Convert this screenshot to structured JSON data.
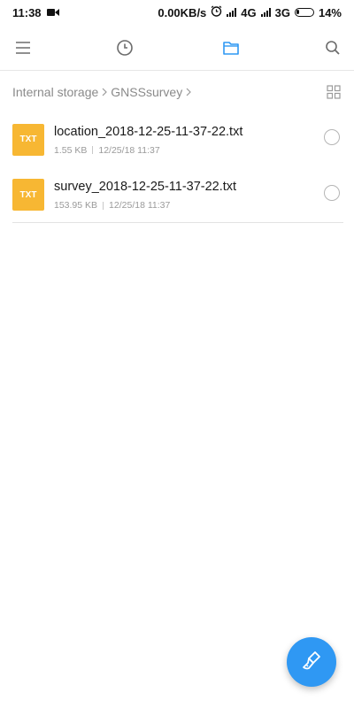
{
  "status_bar": {
    "time": "11:38",
    "speed": "0.00KB/s",
    "network1": "4G",
    "network2": "3G",
    "battery": "14%",
    "icons": [
      "video-record-icon",
      "alarm-icon",
      "signal-icon",
      "signal-icon",
      "battery-icon"
    ]
  },
  "toolbar": {
    "icons": [
      "menu-icon",
      "recent-clock-icon",
      "folder-icon",
      "search-icon"
    ],
    "active": "folder-icon",
    "accent_color": "#2f98f3"
  },
  "breadcrumb": {
    "items": [
      "Internal storage",
      "GNSSsurvey"
    ],
    "view_toggle_icon": "grid-view-icon"
  },
  "files": [
    {
      "type": "TXT",
      "name": "location_2018-12-25-11-37-22.txt",
      "size": "1.55 KB",
      "date": "12/25/18 11:37"
    },
    {
      "type": "TXT",
      "name": "survey_2018-12-25-11-37-22.txt",
      "size": "153.95 KB",
      "date": "12/25/18 11:37"
    }
  ],
  "fab": {
    "icon": "clean-brush-icon",
    "color": "#2f98f3"
  },
  "colors": {
    "txt_badge": "#f7b733"
  }
}
